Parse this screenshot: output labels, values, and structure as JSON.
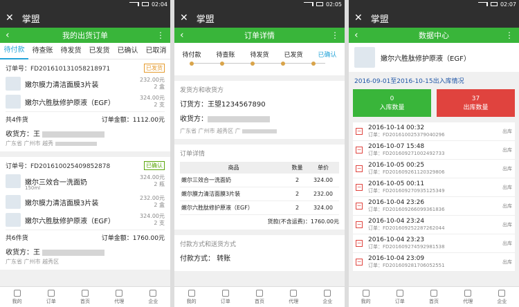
{
  "screens": [
    {
      "time": "02:04",
      "app_title": "掌盟",
      "page_title": "我的出货订单",
      "tabs": [
        "待付款",
        "待查账",
        "待发货",
        "已发货",
        "已确认",
        "已取消"
      ],
      "orders": [
        {
          "order_no": "订单号：FD201610131058218971",
          "status": "已发货",
          "items": [
            {
              "name": "嫩尔膜力清洁面膜3片装",
              "price": "232.00元",
              "qty": "2 盒"
            },
            {
              "name": "嫩尔六胜肽修护原液（EGF）",
              "price": "324.00元",
              "qty": "2 支"
            }
          ],
          "count": "共4件货",
          "total": "订单金额：1112.00元",
          "recipient": "收货方：王",
          "address": "广东省 广州市 越秀"
        },
        {
          "order_no": "订单号：FD201610025409852878",
          "status": "已确认",
          "items": [
            {
              "name": "嫩尔三效合一洗面奶",
              "sub": "150ml",
              "price": "324.00元",
              "qty": "2 瓶"
            },
            {
              "name": "嫩尔膜力清洁面膜3片装",
              "price": "232.00元",
              "qty": "2 盒"
            },
            {
              "name": "嫩尔六胜肽修护原液（EGF）",
              "price": "324.00元",
              "qty": "2 支"
            }
          ],
          "count": "共6件货",
          "total": "订单金额：1760.00元",
          "recipient": "收货方：王",
          "address": "广东省 广州市 越秀区"
        }
      ]
    },
    {
      "time": "02:05",
      "app_title": "掌盟",
      "page_title": "订单详情",
      "steps": [
        "待付款",
        "待查账",
        "待发货",
        "已发货",
        "已确认"
      ],
      "section_parties": "发货方和收货方",
      "shipper": "订货方：王曌1234567890",
      "receiver": "收货方：",
      "receiver_address": "广东省 广州市 越秀区 广",
      "section_details": "订单详情",
      "table_headers": [
        "商品",
        "数量",
        "单价"
      ],
      "table_rows": [
        [
          "嫩尔三效合一洗面奶",
          "2",
          "324.00"
        ],
        [
          "嫩尔膜力清洁面膜3片装",
          "2",
          "232.00"
        ],
        [
          "嫩尔六胜肽修护原液（EGF）",
          "2",
          "324.00"
        ]
      ],
      "total": "货款(不含运费)：1760.00元",
      "section_payment": "付款方式和送货方式",
      "payment": "付款方式：",
      "payment_value": "转账"
    },
    {
      "time": "02:07",
      "app_title": "掌盟",
      "page_title": "数据中心",
      "product": "嫩尔六胜肽修护原液（EGF）",
      "date_range": "2016-09-01至2016-10-15出入库情况",
      "in_count": "0",
      "in_label": "入库数量",
      "out_count": "37",
      "out_label": "出库数量",
      "records": [
        {
          "date": "2016-10-14 00:32",
          "order": "订单：FD2016100253790402​96",
          "type": "出库"
        },
        {
          "date": "2016-10-07 15:48",
          "order": "订单：FD201609271002492733",
          "type": "出库"
        },
        {
          "date": "2016-10-05 00:25",
          "order": "订单：FD201609261120329806",
          "type": "出库"
        },
        {
          "date": "2016-10-05 00:11",
          "order": "订单：FD201609270935125349",
          "type": "出库"
        },
        {
          "date": "2016-10-04 23:26",
          "order": "订单：FD201609266099361836",
          "type": "出库"
        },
        {
          "date": "2016-10-04 23:24",
          "order": "订单：FD201609252287262044",
          "type": "出库"
        },
        {
          "date": "2016-10-04 23:23",
          "order": "订单：FD201609274592981538",
          "type": "出库"
        },
        {
          "date": "2016-10-04 23:09",
          "order": "订单：FD201609281706052551",
          "type": "出库"
        }
      ]
    }
  ],
  "bottom_nav": [
    "我的",
    "订单",
    "首页",
    "代理",
    "企业"
  ]
}
